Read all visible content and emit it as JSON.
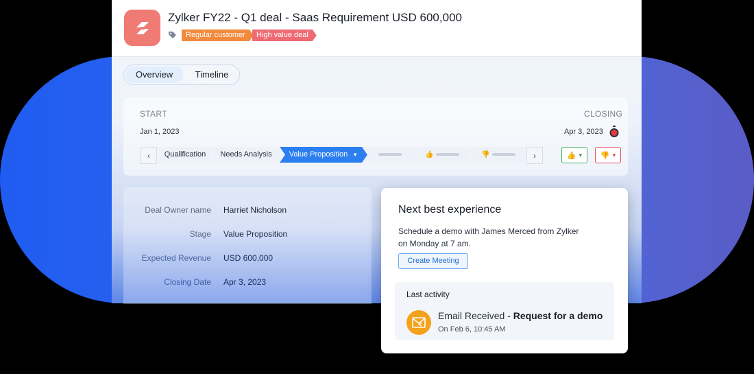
{
  "header": {
    "title": "Zylker FY22 - Q1 deal - Saas Requirement USD 600,000",
    "tags": [
      "Regular customer",
      "High value deal"
    ]
  },
  "tabs": [
    "Overview",
    "Timeline"
  ],
  "stage": {
    "start_label": "START",
    "closing_label": "CLOSING",
    "start_date": "Jan 1, 2023",
    "closing_date": "Apr 3, 2023",
    "stages": [
      "Qualification",
      "Needs Analysis",
      "Value Proposition"
    ],
    "active_stage": "Value Proposition"
  },
  "deal_info": [
    {
      "label": "Deal Owner name",
      "value": "Harriet Nicholson"
    },
    {
      "label": "Stage",
      "value": "Value Proposition"
    },
    {
      "label": "Expected Revenue",
      "value": "USD 600,000"
    },
    {
      "label": "Closing Date",
      "value": "Apr 3, 2023"
    }
  ],
  "next_best": {
    "title": "Next best experience",
    "text_line1": "Schedule a demo with James Merced from Zylker",
    "text_line2": "on Monday at 7 am.",
    "button": "Create Meeting"
  },
  "last_activity": {
    "title": "Last activity",
    "type": "Email Received - ",
    "subject": "Request for a demo",
    "time": "On Feb 6, 10:45 AM"
  },
  "colors": {
    "accent": "#2b7ff0",
    "logo": "#f07a74",
    "tag_orange": "#f28a3d",
    "tag_red": "#ef6b73",
    "mail": "#f3a21a"
  }
}
